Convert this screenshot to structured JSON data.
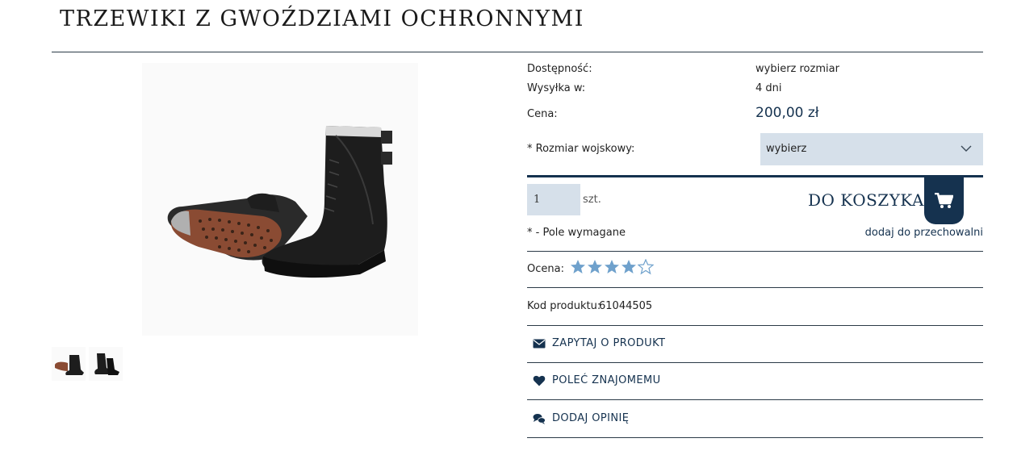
{
  "product": {
    "title": "TRZEWIKI Z GWOŹDZIAMI OCHRONNYMI",
    "availability_label": "Dostępność:",
    "availability_value": "wybierz rozmiar",
    "shipping_label": "Wysyłka w:",
    "shipping_value": "4 dni",
    "price_label": "Cena:",
    "price_value": "200,00 zł",
    "size_label": "* Rozmiar wojskowy:",
    "size_selected": "wybierz",
    "quantity_value": "1",
    "quantity_unit": "szt.",
    "add_to_cart_label": "DO KOSZYKA",
    "required_note": "* - Pole wymagane",
    "wishlist_link": "dodaj do przechowalni",
    "rating_label": "Ocena:",
    "rating": {
      "filled": 4,
      "max": 5
    },
    "code_label": "Kod produktu:",
    "code_value": "61044505"
  },
  "actions": {
    "ask_label": "ZAPYTAJ O PRODUKT",
    "recommend_label": "POLEĆ ZNAJOMEMU",
    "review_label": "DODAJ OPINIĘ"
  },
  "icons": {
    "cart": "cart-icon",
    "chevron": "chevron-down-icon",
    "ask": "envelope-icon",
    "recommend": "heart-icon",
    "review": "comments-icon",
    "star": "star-icon"
  },
  "colors": {
    "navy": "#15324f",
    "field_bg": "#d6e0ea",
    "star_fill": "#6fa1cc"
  }
}
